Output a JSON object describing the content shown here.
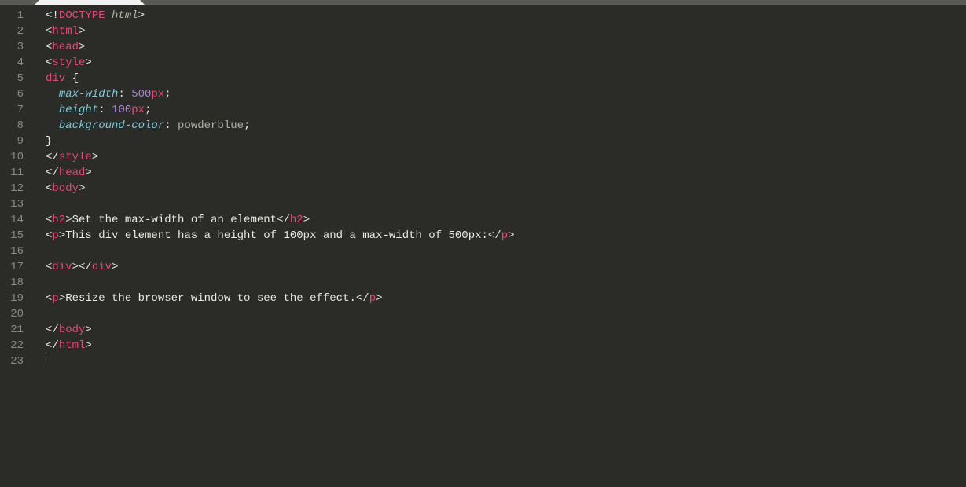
{
  "lineCount": 23,
  "lines": [
    [
      {
        "c": "punc",
        "t": "<!"
      },
      {
        "c": "kw",
        "t": "DOCTYPE"
      },
      {
        "c": "docty",
        "t": " html"
      },
      {
        "c": "punc",
        "t": ">"
      }
    ],
    [
      {
        "c": "punc",
        "t": "<"
      },
      {
        "c": "tag",
        "t": "html"
      },
      {
        "c": "punc",
        "t": ">"
      }
    ],
    [
      {
        "c": "punc",
        "t": "<"
      },
      {
        "c": "tag",
        "t": "head"
      },
      {
        "c": "punc",
        "t": ">"
      }
    ],
    [
      {
        "c": "punc",
        "t": "<"
      },
      {
        "c": "tag",
        "t": "style"
      },
      {
        "c": "punc",
        "t": ">"
      }
    ],
    [
      {
        "c": "sel",
        "t": "div"
      },
      {
        "c": "punc",
        "t": " {"
      }
    ],
    [
      {
        "c": "text",
        "t": "  "
      },
      {
        "c": "prop",
        "t": "max-width"
      },
      {
        "c": "punc",
        "t": ": "
      },
      {
        "c": "num",
        "t": "500"
      },
      {
        "c": "unit",
        "t": "px"
      },
      {
        "c": "punc",
        "t": ";"
      }
    ],
    [
      {
        "c": "text",
        "t": "  "
      },
      {
        "c": "prop",
        "t": "height"
      },
      {
        "c": "punc",
        "t": ": "
      },
      {
        "c": "num",
        "t": "100"
      },
      {
        "c": "unit",
        "t": "px"
      },
      {
        "c": "punc",
        "t": ";"
      }
    ],
    [
      {
        "c": "text",
        "t": "  "
      },
      {
        "c": "prop",
        "t": "background-color"
      },
      {
        "c": "punc",
        "t": ": "
      },
      {
        "c": "val",
        "t": "powderblue"
      },
      {
        "c": "punc",
        "t": ";"
      }
    ],
    [
      {
        "c": "punc",
        "t": "}"
      }
    ],
    [
      {
        "c": "punc",
        "t": "</"
      },
      {
        "c": "tag",
        "t": "style"
      },
      {
        "c": "punc",
        "t": ">"
      }
    ],
    [
      {
        "c": "punc",
        "t": "</"
      },
      {
        "c": "tag",
        "t": "head"
      },
      {
        "c": "punc",
        "t": ">"
      }
    ],
    [
      {
        "c": "punc",
        "t": "<"
      },
      {
        "c": "tag",
        "t": "body"
      },
      {
        "c": "punc",
        "t": ">"
      }
    ],
    [],
    [
      {
        "c": "punc",
        "t": "<"
      },
      {
        "c": "tag",
        "t": "h2"
      },
      {
        "c": "punc",
        "t": ">"
      },
      {
        "c": "text",
        "t": "Set the max-width of an element"
      },
      {
        "c": "punc",
        "t": "</"
      },
      {
        "c": "tag",
        "t": "h2"
      },
      {
        "c": "punc",
        "t": ">"
      }
    ],
    [
      {
        "c": "punc",
        "t": "<"
      },
      {
        "c": "tag",
        "t": "p"
      },
      {
        "c": "punc",
        "t": ">"
      },
      {
        "c": "text",
        "t": "This div element has a height of 100px and a max-width of 500px:"
      },
      {
        "c": "punc",
        "t": "</"
      },
      {
        "c": "tag",
        "t": "p"
      },
      {
        "c": "punc",
        "t": ">"
      }
    ],
    [],
    [
      {
        "c": "punc",
        "t": "<"
      },
      {
        "c": "tag",
        "t": "div"
      },
      {
        "c": "punc",
        "t": "></"
      },
      {
        "c": "tag",
        "t": "div"
      },
      {
        "c": "punc",
        "t": ">"
      }
    ],
    [],
    [
      {
        "c": "punc",
        "t": "<"
      },
      {
        "c": "tag",
        "t": "p"
      },
      {
        "c": "punc",
        "t": ">"
      },
      {
        "c": "text",
        "t": "Resize the browser window to see the effect."
      },
      {
        "c": "punc",
        "t": "</"
      },
      {
        "c": "tag",
        "t": "p"
      },
      {
        "c": "punc",
        "t": ">"
      }
    ],
    [],
    [
      {
        "c": "punc",
        "t": "</"
      },
      {
        "c": "tag",
        "t": "body"
      },
      {
        "c": "punc",
        "t": ">"
      }
    ],
    [
      {
        "c": "punc",
        "t": "</"
      },
      {
        "c": "tag",
        "t": "html"
      },
      {
        "c": "punc",
        "t": ">"
      }
    ],
    []
  ],
  "cursorLine": 23
}
